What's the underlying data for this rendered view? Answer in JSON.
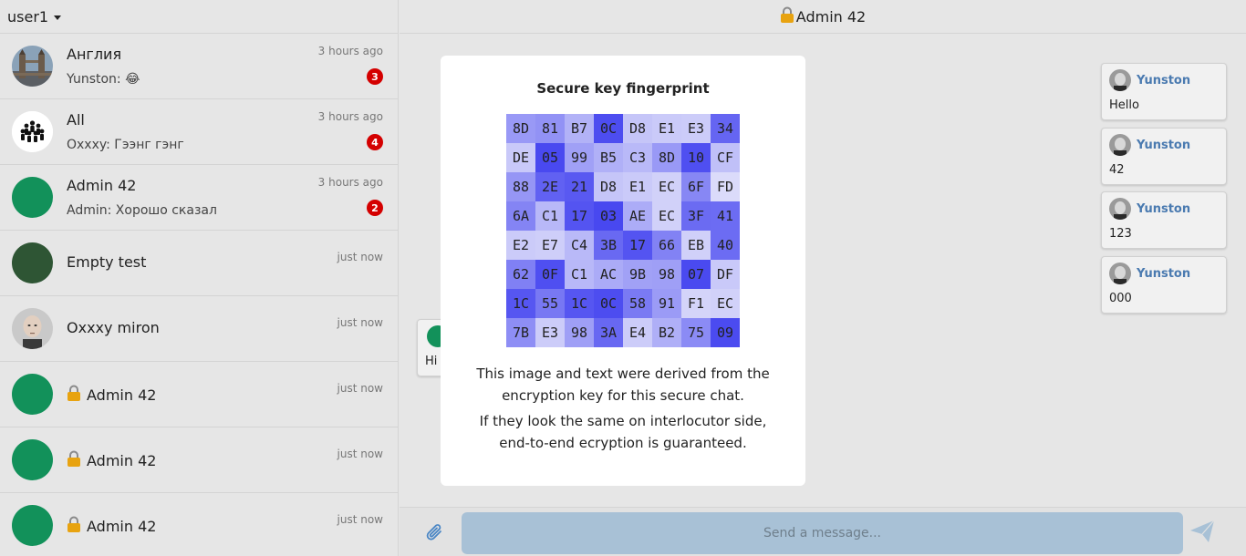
{
  "user_menu": {
    "label": "user1"
  },
  "chats": [
    {
      "name": "Англия",
      "preview": "Yunston: 😂",
      "time": "3 hours ago",
      "badge": "3",
      "avatar": "landmark-photo"
    },
    {
      "name": "All",
      "preview": "Oxxxy: Гээнг гэнг",
      "time": "3 hours ago",
      "badge": "4",
      "avatar": "group-icon"
    },
    {
      "name": "Admin 42",
      "preview": "Admin: Хорошо сказал",
      "time": "3 hours ago",
      "badge": "2",
      "avatar": "green-circle"
    },
    {
      "name": "Empty test",
      "time": "just now",
      "avatar": "dark-green-circle"
    },
    {
      "name": "Oxxxy miron",
      "time": "just now",
      "avatar": "portrait-photo"
    },
    {
      "name": "Admin 42",
      "time": "just now",
      "locked": true,
      "avatar": "green-circle"
    },
    {
      "name": "Admin 42",
      "time": "just now",
      "locked": true,
      "avatar": "green-circle"
    },
    {
      "name": "Admin 42",
      "time": "just now",
      "locked": true,
      "avatar": "green-circle"
    }
  ],
  "header": {
    "title": "Admin 42",
    "locked": true
  },
  "messages": [
    {
      "author": "Yunston",
      "text": "Hello"
    },
    {
      "author": "Yunston",
      "text": "42"
    },
    {
      "author": "Yunston",
      "text": "123"
    },
    {
      "author": "Yunston",
      "text": "000"
    }
  ],
  "incoming_message": {
    "text": "Hi"
  },
  "composer": {
    "placeholder": "Send a message..."
  },
  "modal": {
    "title": "Secure key fingerprint",
    "fingerprint": [
      [
        "8D",
        "81",
        "B7",
        "0C",
        "D8",
        "E1",
        "E3",
        "34"
      ],
      [
        "DE",
        "05",
        "99",
        "B5",
        "C3",
        "8D",
        "10",
        "CF"
      ],
      [
        "88",
        "2E",
        "21",
        "D8",
        "E1",
        "EC",
        "6F",
        "FD"
      ],
      [
        "6A",
        "C1",
        "17",
        "03",
        "AE",
        "EC",
        "3F",
        "41"
      ],
      [
        "E2",
        "E7",
        "C4",
        "3B",
        "17",
        "66",
        "EB",
        "40"
      ],
      [
        "62",
        "0F",
        "C1",
        "AC",
        "9B",
        "98",
        "07",
        "DF"
      ],
      [
        "1C",
        "55",
        "1C",
        "0C",
        "58",
        "91",
        "F1",
        "EC"
      ],
      [
        "7B",
        "E3",
        "98",
        "3A",
        "E4",
        "B2",
        "75",
        "09"
      ]
    ],
    "text1": "This image and text were derived from the encryption key for this secure chat.",
    "text2": "If they look the same on interlocutor side, end-to-end ecryption is guaranteed."
  },
  "colors": {
    "accent_green": "#12915a",
    "badge_red": "#d40000",
    "input_bg": "#a8c1d6",
    "author_blue": "#4a7ab0"
  }
}
